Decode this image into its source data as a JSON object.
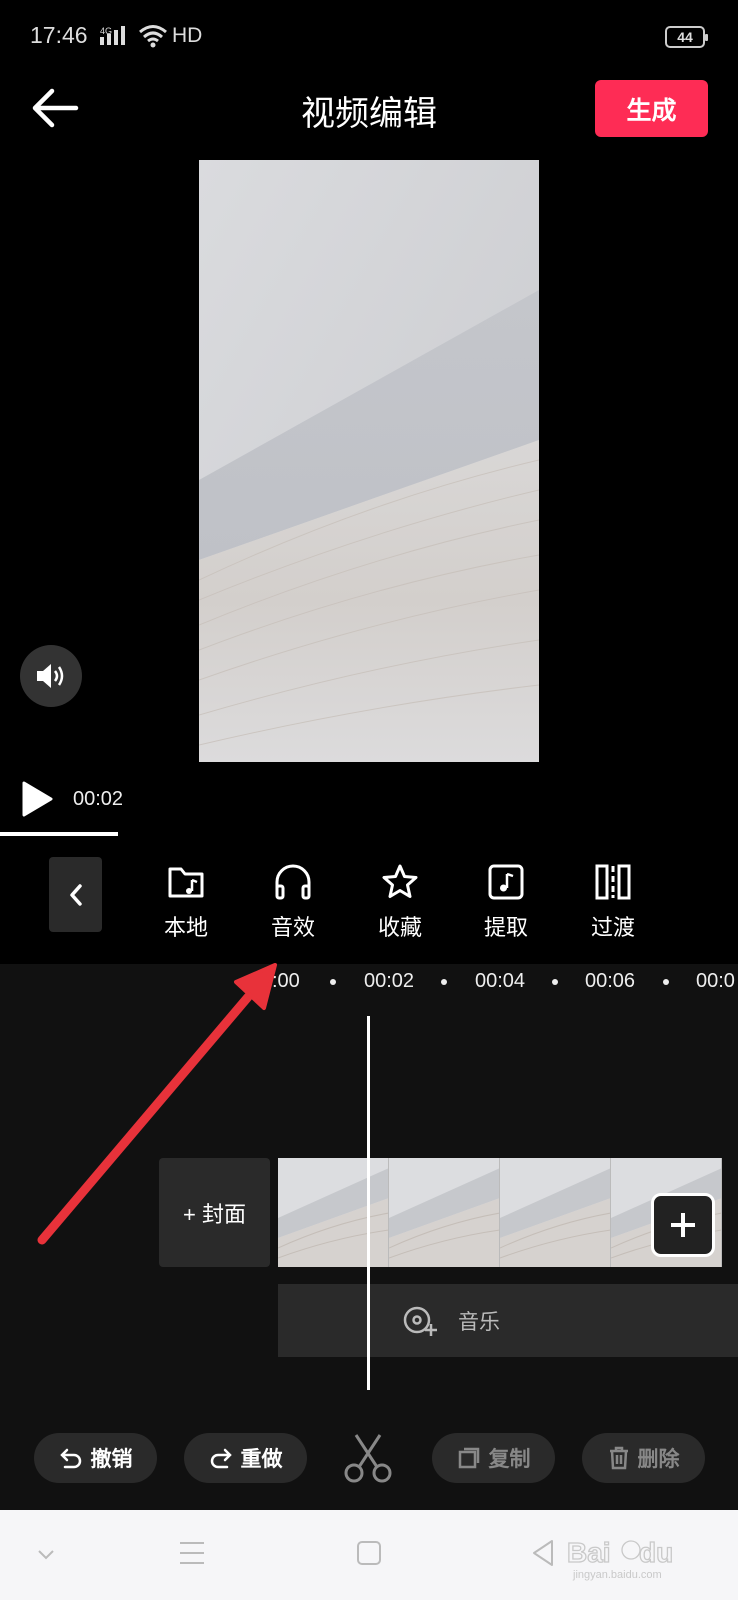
{
  "status_bar": {
    "time": "17:46",
    "network": "4G",
    "hd": "HD",
    "battery": "44"
  },
  "header": {
    "title": "视频编辑",
    "generate_label": "生成"
  },
  "player": {
    "current_time": "00:02"
  },
  "toolbar": {
    "items": [
      {
        "label": "本地",
        "icon": "folder-music-icon"
      },
      {
        "label": "音效",
        "icon": "headphones-icon"
      },
      {
        "label": "收藏",
        "icon": "star-icon"
      },
      {
        "label": "提取",
        "icon": "music-note-icon"
      },
      {
        "label": "过渡",
        "icon": "transition-icon"
      }
    ]
  },
  "timeline": {
    "ruler": [
      ":00",
      "00:02",
      "00:04",
      "00:06",
      "00:0"
    ],
    "cover_label": "+ 封面",
    "music_label": "音乐"
  },
  "actions": {
    "undo": "撤销",
    "redo": "重做",
    "copy": "复制",
    "delete": "删除"
  },
  "colors": {
    "accent": "#fe2c55",
    "annotation_arrow": "#e8323a"
  }
}
